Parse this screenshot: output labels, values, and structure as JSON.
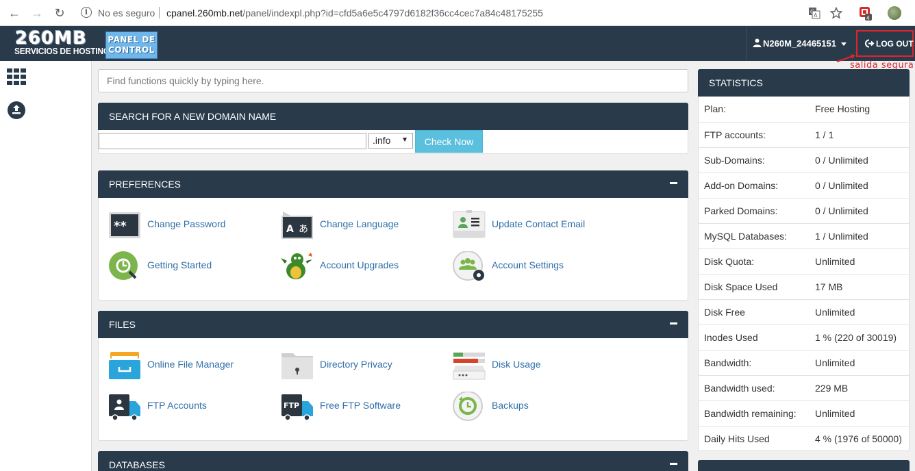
{
  "browser": {
    "insecure_label": "No es seguro",
    "url_host": "cpanel.260mb.net",
    "url_path": "/panel/indexpl.php?id=cfd5a6e5c4797d6182f36cc4cec7a84c48175255",
    "extension_badge": "4"
  },
  "header": {
    "logo_big": "260MB",
    "logo_small": "SERVICIOS DE HOSTING",
    "panel_badge_line1": "PANEL DE",
    "panel_badge_line2": "CONTROL",
    "username": "N260M_24465151",
    "logout_label": "LOG OUT",
    "annotation": "salida segura"
  },
  "search": {
    "placeholder": "Find functions quickly by typing here."
  },
  "domain_search": {
    "title": "SEARCH FOR A NEW DOMAIN NAME",
    "tld_selected": ".info",
    "button_label": "Check Now"
  },
  "preferences": {
    "title": "PREFERENCES",
    "items": [
      {
        "label": "Change Password",
        "icon": "password-icon"
      },
      {
        "label": "Change Language",
        "icon": "language-icon"
      },
      {
        "label": "Update Contact Email",
        "icon": "contact-card-icon"
      },
      {
        "label": "Getting Started",
        "icon": "getting-started-icon"
      },
      {
        "label": "Account Upgrades",
        "icon": "dragon-icon"
      },
      {
        "label": "Account Settings",
        "icon": "users-gear-icon"
      }
    ]
  },
  "files": {
    "title": "FILES",
    "items": [
      {
        "label": "Online File Manager",
        "icon": "file-manager-icon"
      },
      {
        "label": "Directory Privacy",
        "icon": "folder-lock-icon"
      },
      {
        "label": "Disk Usage",
        "icon": "disk-usage-icon"
      },
      {
        "label": "FTP Accounts",
        "icon": "ftp-accounts-icon"
      },
      {
        "label": "Free FTP Software",
        "icon": "ftp-software-icon"
      },
      {
        "label": "Backups",
        "icon": "backups-icon"
      }
    ]
  },
  "databases": {
    "title": "DATABASES"
  },
  "statistics": {
    "title": "STATISTICS",
    "rows": [
      {
        "key": "Plan:",
        "value": "Free Hosting"
      },
      {
        "key": "FTP accounts:",
        "value": "1 / 1"
      },
      {
        "key": "Sub-Domains:",
        "value": "0 / Unlimited"
      },
      {
        "key": "Add-on Domains:",
        "value": "0 / Unlimited"
      },
      {
        "key": "Parked Domains:",
        "value": "0 / Unlimited"
      },
      {
        "key": "MySQL Databases:",
        "value": "1 / Unlimited"
      },
      {
        "key": "Disk Quota:",
        "value": "Unlimited"
      },
      {
        "key": "Disk Space Used",
        "value": "17 MB"
      },
      {
        "key": "Disk Free",
        "value": "Unlimited"
      },
      {
        "key": "Inodes Used",
        "value": "1 % (220 of 30019)"
      },
      {
        "key": "Bandwidth:",
        "value": "Unlimited"
      },
      {
        "key": "Bandwidth used:",
        "value": "229 MB"
      },
      {
        "key": "Bandwidth remaining:",
        "value": "Unlimited"
      },
      {
        "key": "Daily Hits Used",
        "value": "4 % (1976 of 50000)"
      }
    ]
  }
}
